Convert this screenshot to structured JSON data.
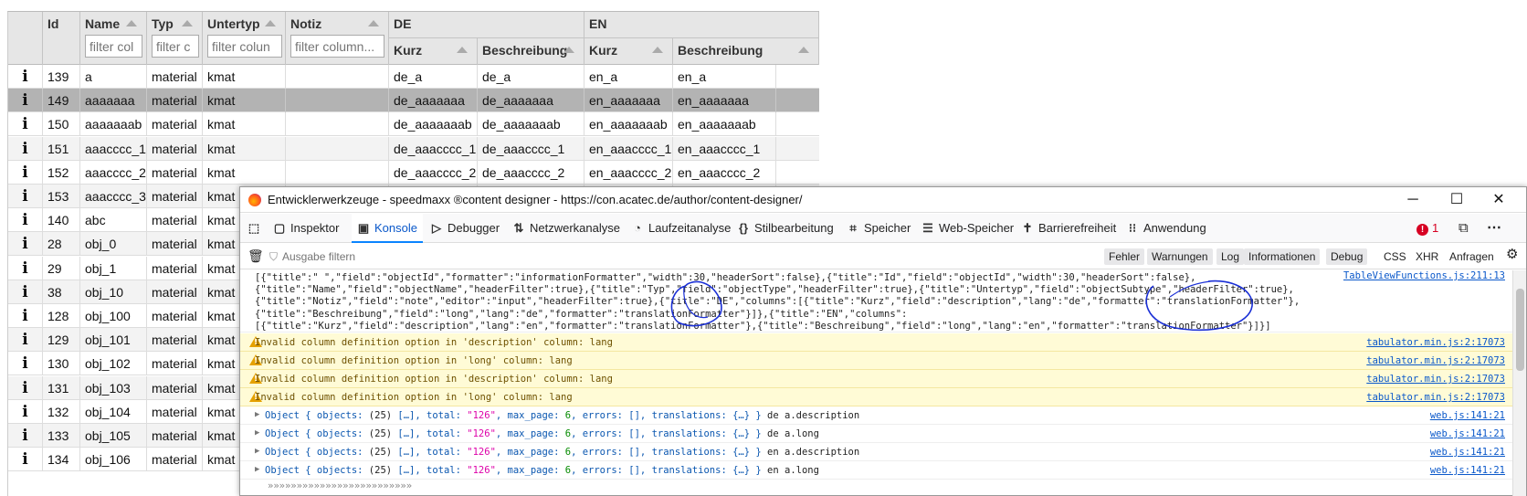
{
  "table": {
    "headers": {
      "id": "Id",
      "name": "Name",
      "typ": "Typ",
      "untertyp": "Untertyp",
      "notiz": "Notiz",
      "de_group": "DE",
      "en_group": "EN",
      "kurz": "Kurz",
      "beschreibung": "Beschreibung"
    },
    "filters": {
      "name": "filter col",
      "typ": "filter c",
      "untertyp": "filter colun",
      "notiz": "filter column..."
    },
    "rows": [
      {
        "id": "139",
        "name": "a",
        "typ": "material",
        "untertyp": "kmat",
        "de_kurz": "de_a",
        "de_beschr": "de_a",
        "en_kurz": "en_a",
        "en_beschr": "en_a"
      },
      {
        "id": "149",
        "name": "aaaaaaa",
        "typ": "material",
        "untertyp": "kmat",
        "de_kurz": "de_aaaaaaa",
        "de_beschr": "de_aaaaaaa",
        "en_kurz": "en_aaaaaaa",
        "en_beschr": "en_aaaaaaa"
      },
      {
        "id": "150",
        "name": "aaaaaaab",
        "typ": "material",
        "untertyp": "kmat",
        "de_kurz": "de_aaaaaaab",
        "de_beschr": "de_aaaaaaab",
        "en_kurz": "en_aaaaaaab",
        "en_beschr": "en_aaaaaaab"
      },
      {
        "id": "151",
        "name": "aaacccc_1",
        "typ": "material",
        "untertyp": "kmat",
        "de_kurz": "de_aaacccc_1",
        "de_beschr": "de_aaacccc_1",
        "en_kurz": "en_aaacccc_1",
        "en_beschr": "en_aaacccc_1"
      },
      {
        "id": "152",
        "name": "aaacccc_2",
        "typ": "material",
        "untertyp": "kmat",
        "de_kurz": "de_aaacccc_2",
        "de_beschr": "de_aaacccc_2",
        "en_kurz": "en_aaacccc_2",
        "en_beschr": "en_aaacccc_2"
      },
      {
        "id": "153",
        "name": "aaacccc_3",
        "typ": "material",
        "untertyp": "kmat"
      },
      {
        "id": "140",
        "name": "abc",
        "typ": "material",
        "untertyp": "kmat"
      },
      {
        "id": "28",
        "name": "obj_0",
        "typ": "material",
        "untertyp": "kmat"
      },
      {
        "id": "29",
        "name": "obj_1",
        "typ": "material",
        "untertyp": "kmat"
      },
      {
        "id": "38",
        "name": "obj_10",
        "typ": "material",
        "untertyp": "kmat"
      },
      {
        "id": "128",
        "name": "obj_100",
        "typ": "material",
        "untertyp": "kmat"
      },
      {
        "id": "129",
        "name": "obj_101",
        "typ": "material",
        "untertyp": "kmat"
      },
      {
        "id": "130",
        "name": "obj_102",
        "typ": "material",
        "untertyp": "kmat"
      },
      {
        "id": "131",
        "name": "obj_103",
        "typ": "material",
        "untertyp": "kmat"
      },
      {
        "id": "132",
        "name": "obj_104",
        "typ": "material",
        "untertyp": "kmat"
      },
      {
        "id": "133",
        "name": "obj_105",
        "typ": "material",
        "untertyp": "kmat"
      },
      {
        "id": "134",
        "name": "obj_106",
        "typ": "material",
        "untertyp": "kmat"
      }
    ]
  },
  "devtools": {
    "window_title": "Entwicklerwerkzeuge - speedmaxx ®content designer - https://con.acatec.de/author/content-designer/",
    "tabs": [
      "Inspektor",
      "Konsole",
      "Debugger",
      "Netzwerkanalyse",
      "Laufzeitanalyse",
      "Stilbearbeitung",
      "Speicher",
      "Web-Speicher",
      "Barrierefreiheit",
      "Anwendung"
    ],
    "error_count": "1",
    "filter_placeholder": "Ausgabe filtern",
    "level_filters": [
      "Fehler",
      "Warnungen",
      "Log",
      "Informationen",
      "Debug"
    ],
    "type_filters": [
      "CSS",
      "XHR",
      "Anfragen"
    ],
    "log_lines": [
      "[{\"title\":\" \",\"field\":\"objectId\",\"formatter\":\"informationFormatter\",\"width\":30,\"headerSort\":false},{\"title\":\"Id\",\"field\":\"objectId\",\"width\":30,\"headerSort\":false},",
      "{\"title\":\"Name\",\"field\":\"objectName\",\"headerFilter\":true},{\"title\":\"Typ\",\"field\":\"objectType\",\"headerFilter\":true},{\"title\":\"Untertyp\",\"field\":\"objectSubtype\",\"headerFilter\":true},",
      "{\"title\":\"Notiz\",\"field\":\"note\",\"editor\":\"input\",\"headerFilter\":true},{\"title\":\"DE\",\"columns\":[{\"title\":\"Kurz\",\"field\":\"description\",\"lang\":\"de\",\"formatter\":\"translationFormatter\"},",
      "{\"title\":\"Beschreibung\",\"field\":\"long\",\"lang\":\"de\",\"formatter\":\"translationFormatter\"}]},{\"title\":\"EN\",\"columns\":",
      "[{\"title\":\"Kurz\",\"field\":\"description\",\"lang\":\"en\",\"formatter\":\"translationFormatter\"},{\"title\":\"Beschreibung\",\"field\":\"long\",\"lang\":\"en\",\"formatter\":\"translationFormatter\"}]}]"
    ],
    "log_source": "TableViewFunctions.js:211:13",
    "warnings": [
      {
        "text": "Invalid column definition option in 'description' column: lang",
        "source": "tabulator.min.js:2:17073"
      },
      {
        "text": "Invalid column definition option in 'long' column: lang",
        "source": "tabulator.min.js:2:17073"
      },
      {
        "text": "Invalid column definition option in 'description' column: lang",
        "source": "tabulator.min.js:2:17073"
      },
      {
        "text": "Invalid column definition option in 'long' column: lang",
        "source": "tabulator.min.js:2:17073"
      }
    ],
    "objects": [
      {
        "suffix": "de a.description",
        "source": "web.js:141:21"
      },
      {
        "suffix": "de a.long",
        "source": "web.js:141:21"
      },
      {
        "suffix": "en a.description",
        "source": "web.js:141:21"
      },
      {
        "suffix": "en a.long",
        "source": "web.js:141:21"
      }
    ],
    "object_parts": {
      "prefix": "Object { objects: ",
      "count": "(25)",
      "arr": " […], total: ",
      "total": "\"126\"",
      "maxpage_k": ", max_page: ",
      "maxpage": "6",
      "rest": ", errors: [], translations: {…} }"
    },
    "partial_line": "»»»»»»»»»»»»»»»»»»»»»»»»»"
  },
  "colors": {
    "selected_row": "#b3b3b3",
    "warning_bg": "#fffbd6",
    "link": "#0a58ca",
    "annotation": "#1a2fd6"
  }
}
